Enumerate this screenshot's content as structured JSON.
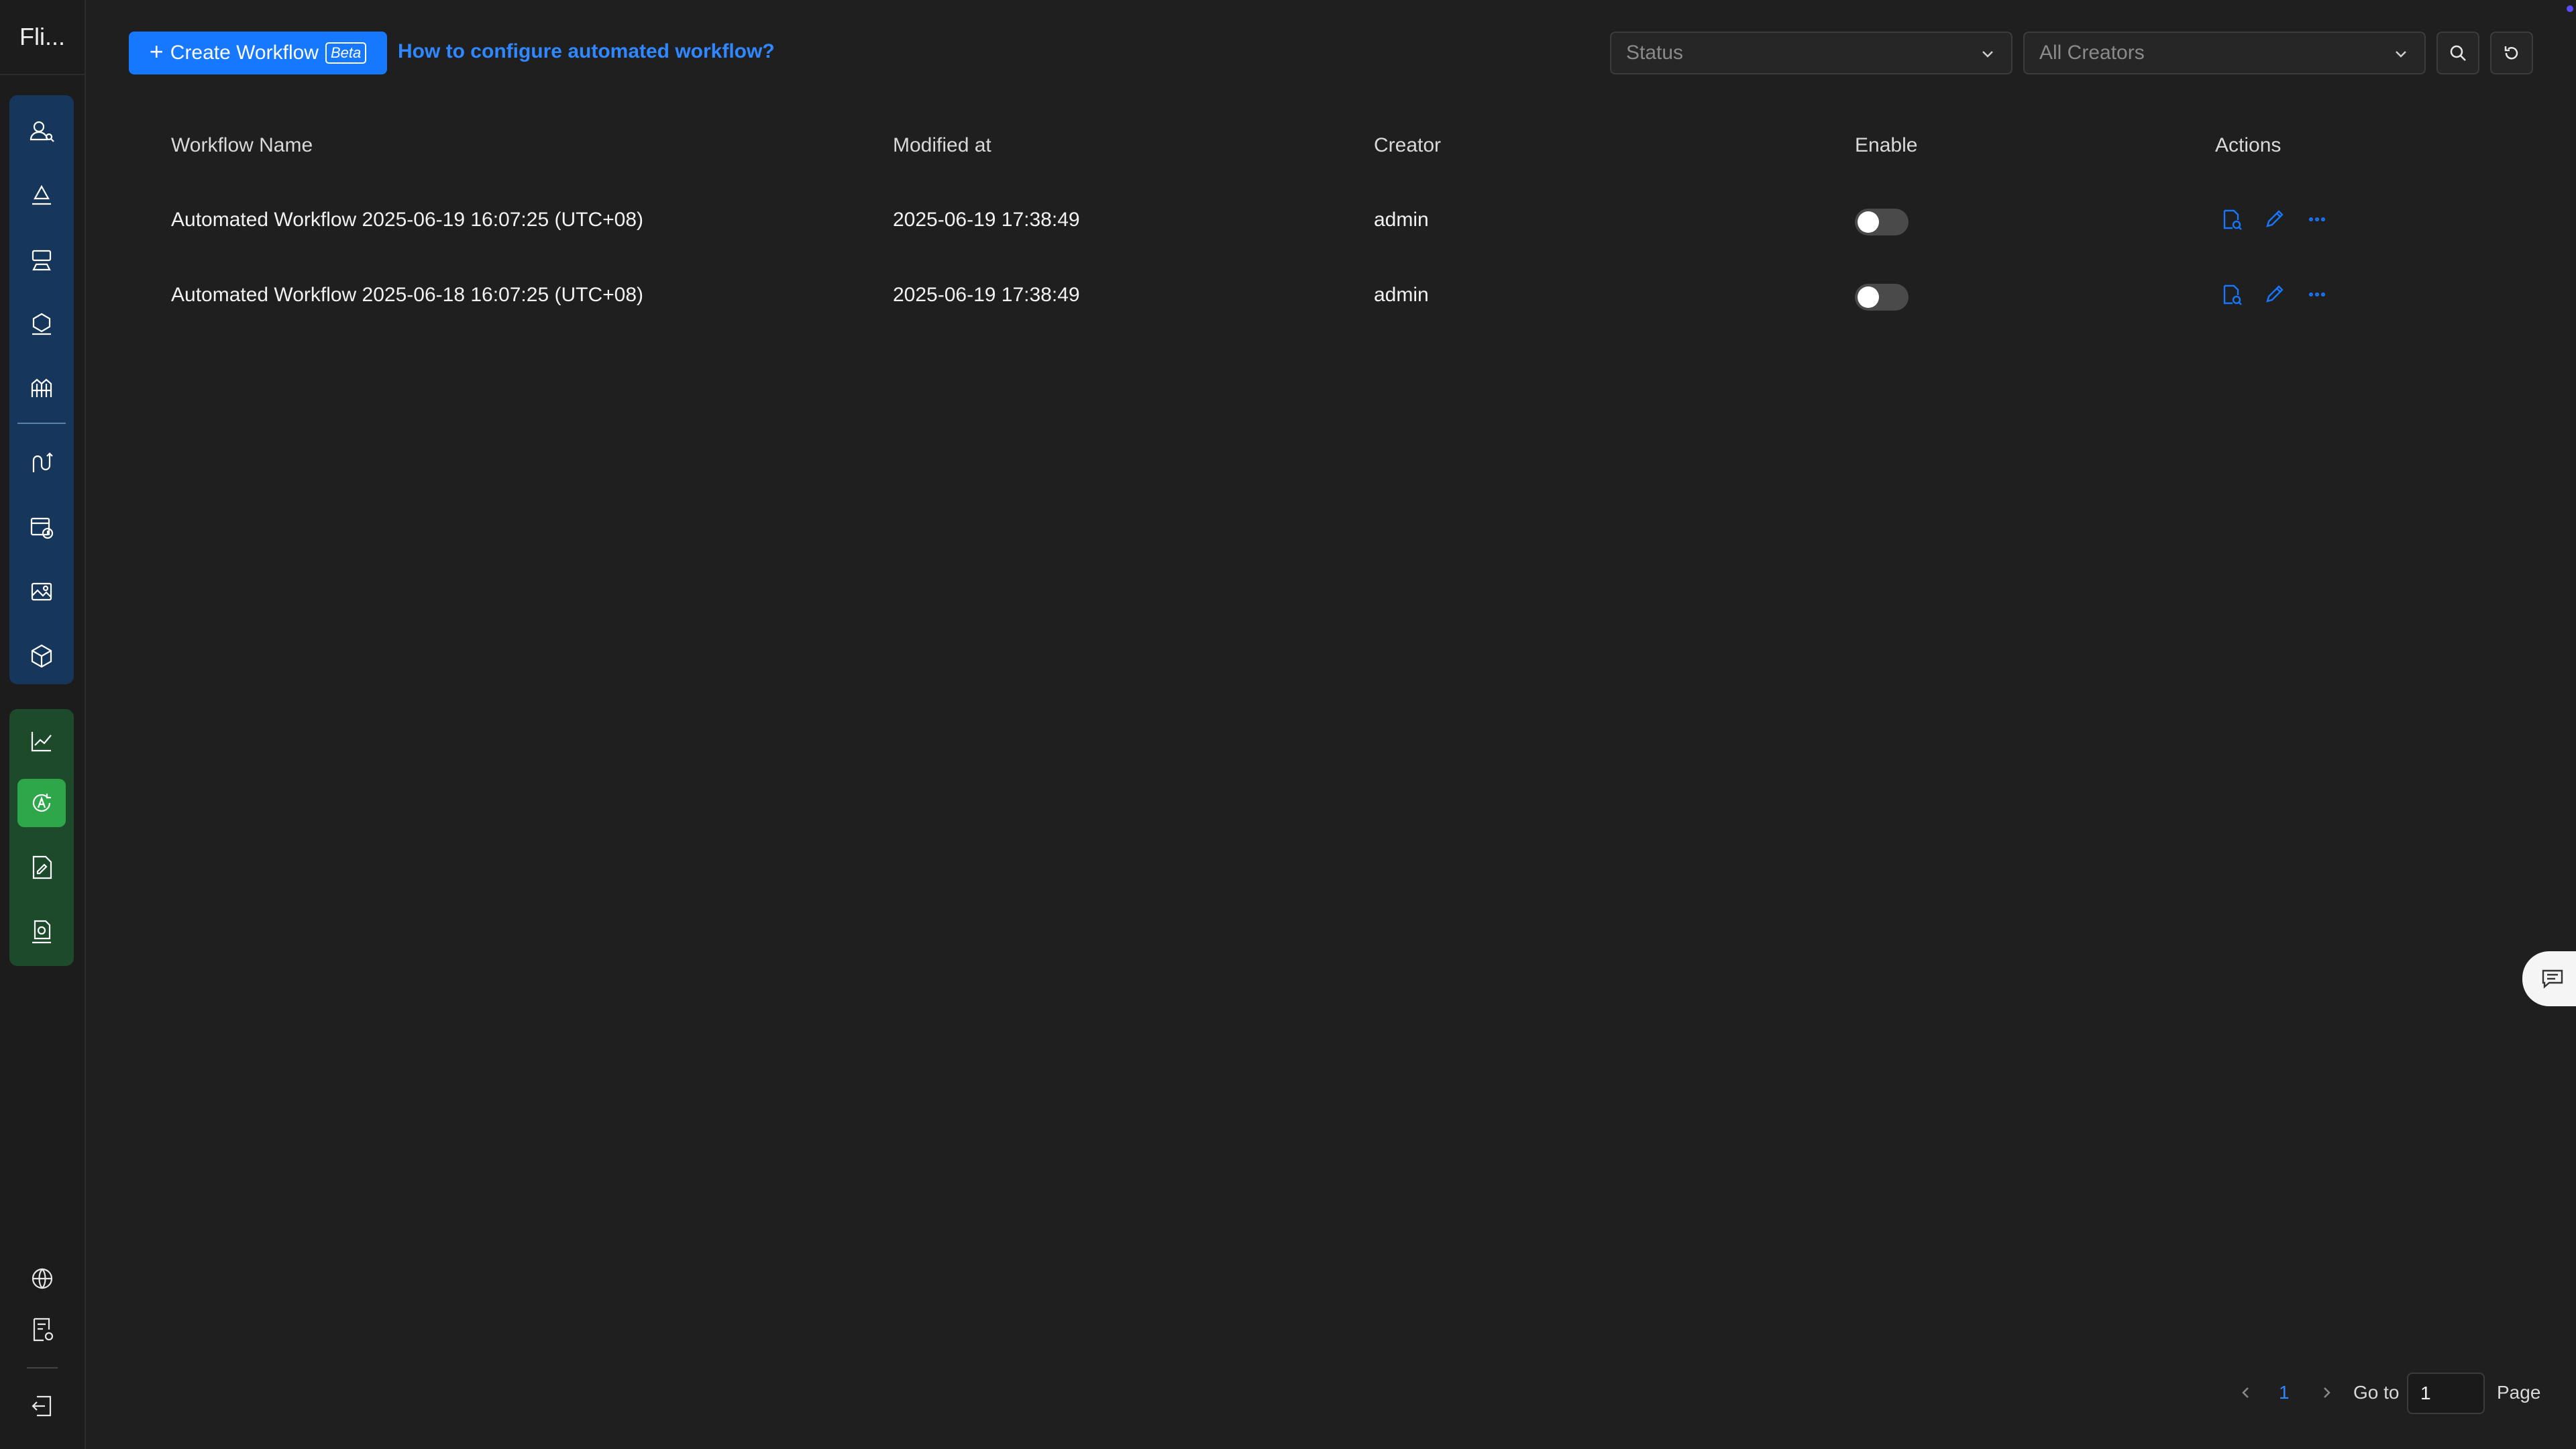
{
  "app": {
    "brand": "Fli..."
  },
  "toolbar": {
    "create_label": "Create Workflow",
    "beta_label": "Beta",
    "help_link": "How to configure automated workflow?",
    "status_placeholder": "Status",
    "creators_value": "All Creators"
  },
  "table": {
    "headers": {
      "name": "Workflow Name",
      "modified": "Modified at",
      "creator": "Creator",
      "enable": "Enable",
      "actions": "Actions"
    },
    "rows": [
      {
        "name": "Automated Workflow 2025-06-19 16:07:25 (UTC+08)",
        "modified": "2025-06-19 17:38:49",
        "creator": "admin",
        "enabled": false
      },
      {
        "name": "Automated Workflow 2025-06-18 16:07:25 (UTC+08)",
        "modified": "2025-06-19 17:38:49",
        "creator": "admin",
        "enabled": false
      }
    ]
  },
  "pagination": {
    "current_page": "1",
    "goto_label": "Go to",
    "goto_value": "1",
    "page_label": "Page"
  },
  "colors": {
    "accent": "#1677ff",
    "active_nav": "#2ea74b",
    "nav_group_blue": "#17365c",
    "nav_group_green": "#1c4a2a"
  }
}
